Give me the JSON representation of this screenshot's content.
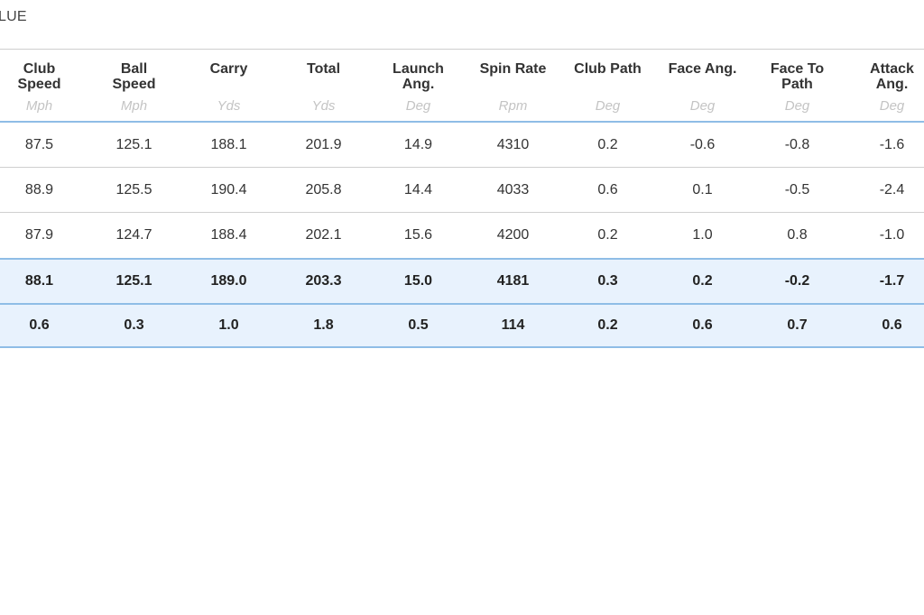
{
  "title_fragment": "LUE",
  "columns": [
    {
      "name": "Club\nSpeed",
      "unit": "Mph"
    },
    {
      "name": "Ball\nSpeed",
      "unit": "Mph"
    },
    {
      "name": "Carry",
      "unit": "Yds"
    },
    {
      "name": "Total",
      "unit": "Yds"
    },
    {
      "name": "Launch\nAng.",
      "unit": "Deg"
    },
    {
      "name": "Spin Rate",
      "unit": "Rpm"
    },
    {
      "name": "Club Path",
      "unit": "Deg"
    },
    {
      "name": "Face Ang.",
      "unit": "Deg"
    },
    {
      "name": "Face To\nPath",
      "unit": "Deg"
    },
    {
      "name": "Attack\nAng.",
      "unit": "Deg"
    }
  ],
  "shots": [
    [
      "87.5",
      "125.1",
      "188.1",
      "201.9",
      "14.9",
      "4310",
      "0.2",
      "-0.6",
      "-0.8",
      "-1.6"
    ],
    [
      "88.9",
      "125.5",
      "190.4",
      "205.8",
      "14.4",
      "4033",
      "0.6",
      "0.1",
      "-0.5",
      "-2.4"
    ],
    [
      "87.9",
      "124.7",
      "188.4",
      "202.1",
      "15.6",
      "4200",
      "0.2",
      "1.0",
      "0.8",
      "-1.0"
    ]
  ],
  "summary_rows": [
    [
      "88.1",
      "125.1",
      "189.0",
      "203.3",
      "15.0",
      "4181",
      "0.3",
      "0.2",
      "-0.2",
      "-1.7"
    ],
    [
      "0.6",
      "0.3",
      "1.0",
      "1.8",
      "0.5",
      "114",
      "0.2",
      "0.6",
      "0.7",
      "0.6"
    ]
  ]
}
